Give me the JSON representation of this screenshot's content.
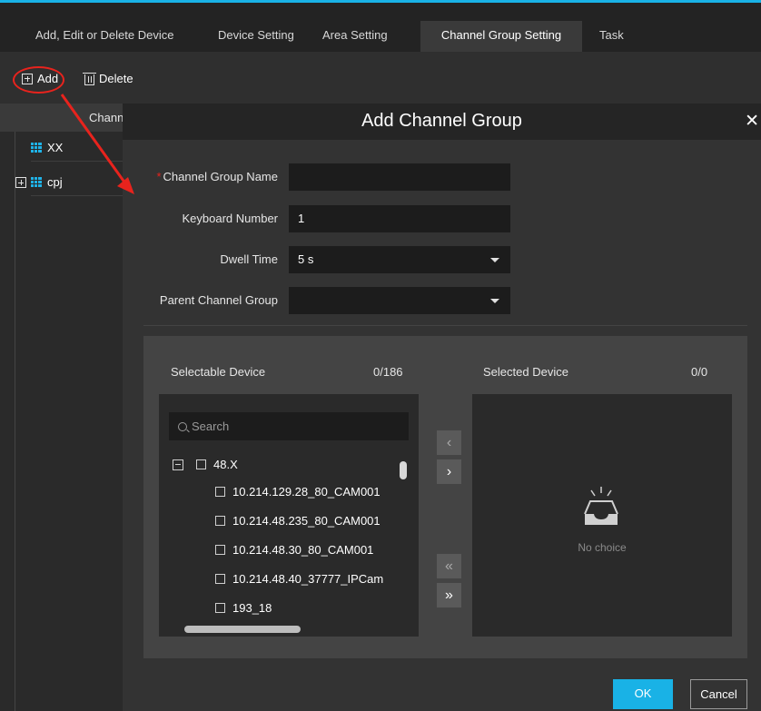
{
  "tabs": [
    {
      "label": "Add, Edit or Delete Device"
    },
    {
      "label": "Device Setting"
    },
    {
      "label": "Area Setting"
    },
    {
      "label": "Channel Group Setting",
      "active": true
    },
    {
      "label": "Task"
    }
  ],
  "toolbar": {
    "add_label": "Add",
    "delete_label": "Delete"
  },
  "left_panel": {
    "header": "Chann",
    "items": [
      {
        "label": "XX"
      },
      {
        "label": "cpj"
      }
    ]
  },
  "dialog": {
    "title": "Add Channel Group",
    "close_label": "✕",
    "required_mark": "*",
    "fields": {
      "name": {
        "label": "Channel Group Name",
        "value": ""
      },
      "keyboard": {
        "label": "Keyboard Number",
        "value": "1"
      },
      "dwell": {
        "label": "Dwell Time",
        "value": "5 s"
      },
      "parent": {
        "label": "Parent Channel Group",
        "value": ""
      }
    },
    "selectable": {
      "label": "Selectable Device",
      "count": "0/186",
      "search_placeholder": "Search",
      "group": "48.X",
      "devices": [
        "10.214.129.28_80_CAM001",
        "10.214.48.235_80_CAM001",
        "10.214.48.30_80_CAM001",
        "10.214.48.40_37777_IPCam",
        "193_18"
      ]
    },
    "selected": {
      "label": "Selected Device",
      "count": "0/0",
      "empty_text": "No choice"
    },
    "transfer_buttons": {
      "left": "‹",
      "right": "›",
      "left_all": "«",
      "right_all": "»"
    },
    "ok_label": "OK",
    "cancel_label": "Cancel"
  },
  "colors": {
    "accent": "#19b2e6",
    "annotation": "#e8231d"
  }
}
